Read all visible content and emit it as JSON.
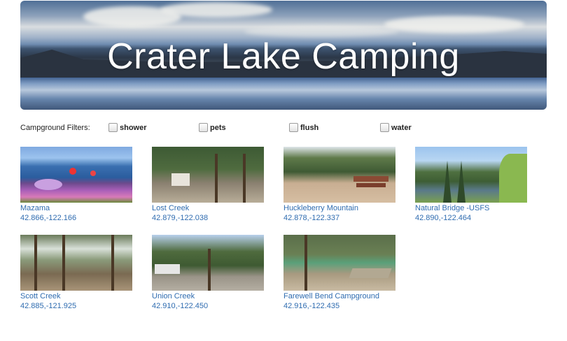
{
  "header": {
    "title": "Crater Lake Camping"
  },
  "filters": {
    "label": "Campground Filters:",
    "options": [
      {
        "label": "shower",
        "checked": false
      },
      {
        "label": "pets",
        "checked": false
      },
      {
        "label": "flush",
        "checked": false
      },
      {
        "label": "water",
        "checked": false
      }
    ]
  },
  "campgrounds": [
    {
      "name": "Mazama",
      "coords": "42.866,-122.166"
    },
    {
      "name": "Lost Creek",
      "coords": "42.879,-122.038"
    },
    {
      "name": "Huckleberry Mountain",
      "coords": "42.878,-122.337"
    },
    {
      "name": "Natural Bridge -USFS",
      "coords": "42.890,-122.464"
    },
    {
      "name": "Scott Creek",
      "coords": "42.885,-121.925"
    },
    {
      "name": "Union Creek",
      "coords": "42.910,-122.450"
    },
    {
      "name": "Farewell Bend Campground",
      "coords": "42.916,-122.435"
    }
  ],
  "colors": {
    "link": "#2f6cb0",
    "text": "#222222",
    "background": "#ffffff"
  }
}
